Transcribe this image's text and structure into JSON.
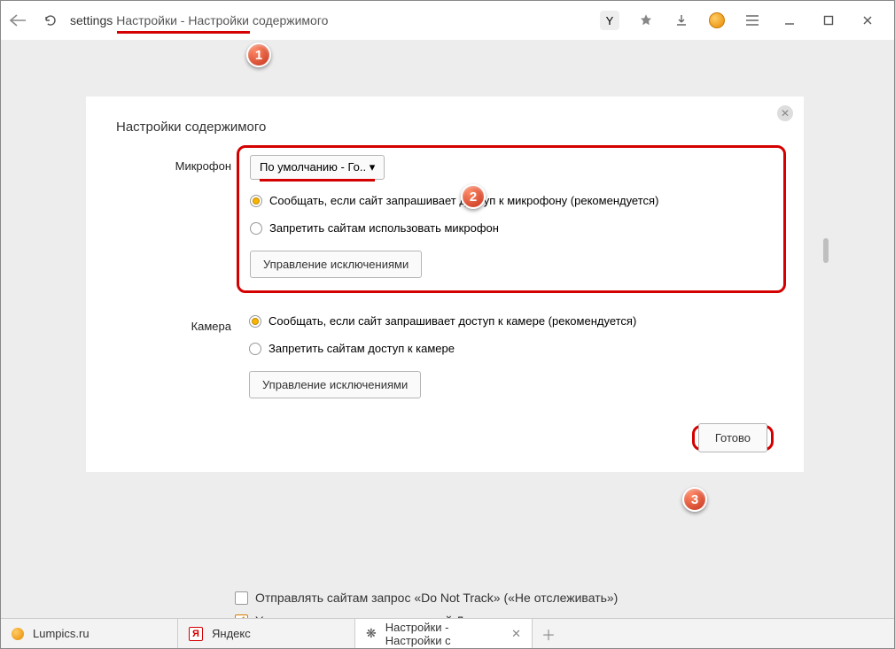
{
  "titlebar": {
    "address_prefix": "settings",
    "address_rest": "Настройки - Настройки содержимого",
    "y_pill_glyph": "Y"
  },
  "modal": {
    "title": "Настройки содержимого",
    "microphone": {
      "label": "Микрофон",
      "dropdown": "По умолчанию - Го..",
      "option_ask": "Сообщать, если сайт запрашивает доступ к микрофону (рекомендуется)",
      "option_block": "Запретить сайтам использовать микрофон",
      "manage": "Управление исключениями"
    },
    "camera": {
      "label": "Камера",
      "option_ask": "Сообщать, если сайт запрашивает доступ к камере (рекомендуется)",
      "option_block": "Запретить сайтам доступ к камере",
      "manage": "Управление исключениями"
    },
    "done": "Готово"
  },
  "background": {
    "dnt": "Отправлять сайтам запрос «Do Not Track» («Не отслеживать»)",
    "dzen": "Улучшать точность рекомендаций Дзена и качество рекламы с помощью"
  },
  "tabs": {
    "t1": "Lumpics.ru",
    "t2": "Яндекс",
    "t3": "Настройки - Настройки с"
  },
  "badges": {
    "b1": "1",
    "b2": "2",
    "b3": "3"
  }
}
